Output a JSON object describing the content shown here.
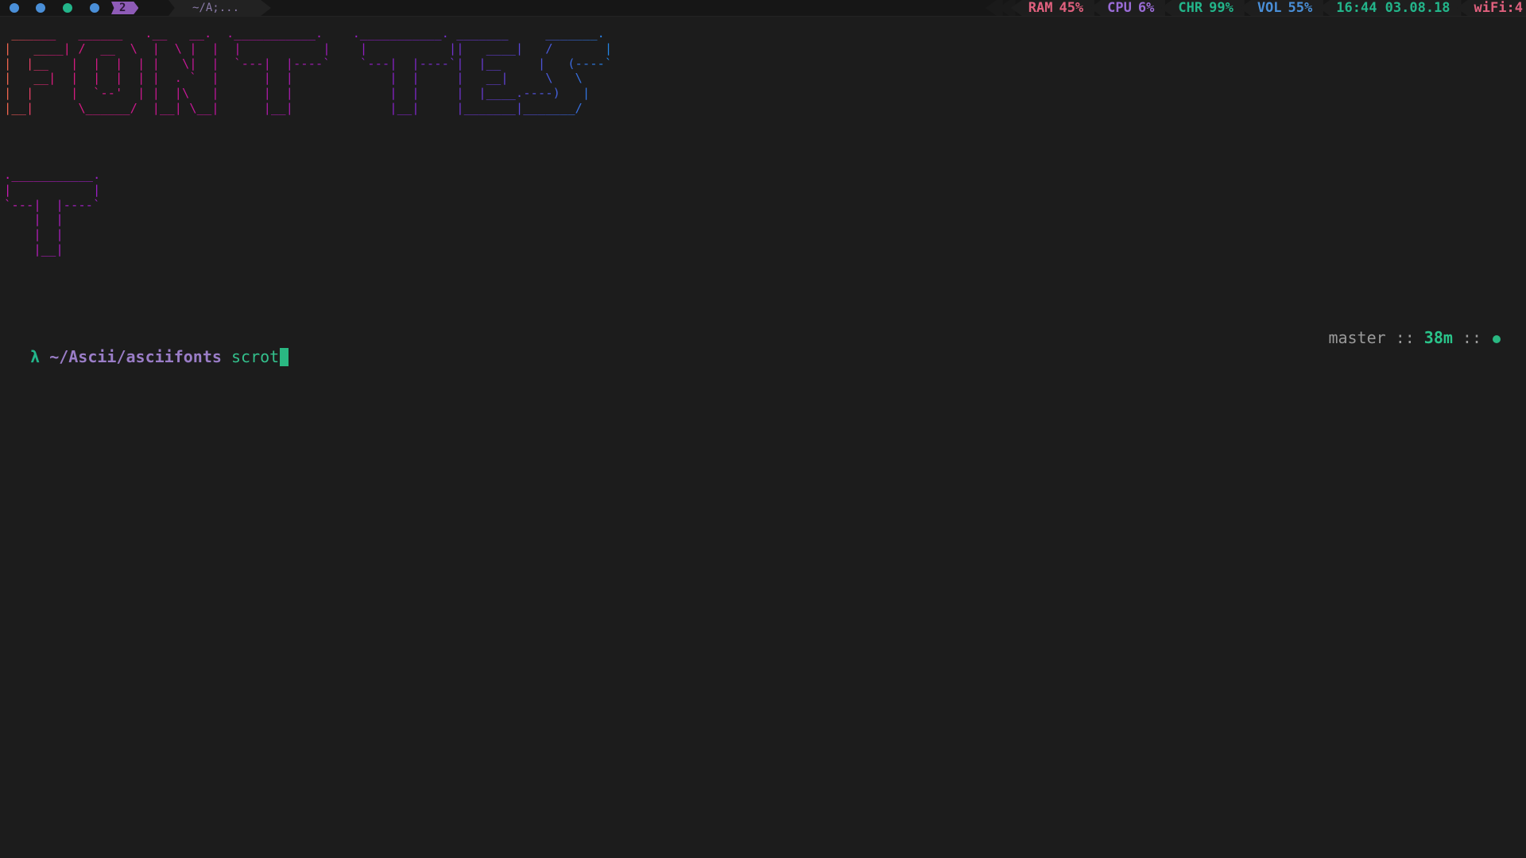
{
  "statusbar": {
    "workspace_dots": [
      {
        "name": "workspace-dot-1",
        "color": "#4a8fd8"
      },
      {
        "name": "workspace-dot-2",
        "color": "#4a8fd8"
      },
      {
        "name": "workspace-dot-3",
        "color": "#23b58a"
      },
      {
        "name": "workspace-dot-4",
        "color": "#4a8fd8"
      }
    ],
    "active_workspace": "2",
    "window_title": "~/A;...",
    "ram": {
      "label": "RAM",
      "value": "45%",
      "color": "#e0607e"
    },
    "cpu": {
      "label": "CPU",
      "value": "6%",
      "color": "#9a6cd6"
    },
    "chr": {
      "label": "CHR",
      "value": "99%",
      "color": "#23b58a"
    },
    "vol": {
      "label": "VOL",
      "value": "55%",
      "color": "#4a8fd8"
    },
    "datetime": "16:44 03.08.18",
    "wifi": {
      "label": "wiFi",
      "value": "4",
      "color": "#e0607e"
    }
  },
  "terminal": {
    "ascii_line1": " ______   ______   .__   __.  .___________.    .___________. _______     _______.\n|   ____| /  __  \\  |  \\ |  |  |           |    |           ||   ____|   /       |\n|  |__   |  |  |  | |   \\|  |  `---|  |----`    `---|  |----`|  |__     |   (----`\n|   __|  |  |  |  | |  . `  |      |  |             |  |     |   __|     \\   \\    \n|  |     |  `--'  | |  |\\   |      |  |             |  |     |  |____.----)   |   \n|__|      \\______/  |__| \\__|      |__|             |__|     |_______|_______/    ",
    "ascii_line2": ".___________.\n|           |\n`---|  |----`\n    |  |     \n    |  |     \n    |__|     ",
    "prompt": {
      "symbol": "λ",
      "cwd": "~/Ascii/asciifonts",
      "command": "scrot"
    },
    "rprompt": {
      "branch": "master",
      "separator": "::",
      "duration": "38m"
    }
  }
}
